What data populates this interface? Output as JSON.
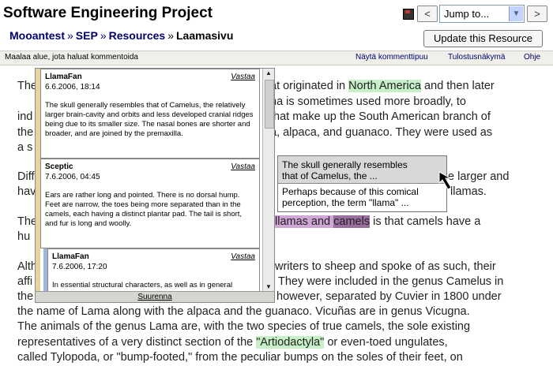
{
  "header": {
    "title": "Software Engineering Project",
    "prev_label": "<",
    "next_label": ">",
    "jump_label": "Jump to...",
    "jump_arrow": "▼"
  },
  "breadcrumb": {
    "items": [
      "Mooantest",
      "SEP",
      "Resources"
    ],
    "separator": "»",
    "current": "Laamasivu"
  },
  "update_button": "Update this Resource",
  "toolbar": {
    "hint": "Maalaa alue, jota haluat kommentoida",
    "links": [
      "Näytä kommenttipuu",
      "Tulostusnäkymä",
      "Ohje"
    ]
  },
  "content": {
    "lines": [
      {
        "pre": "The",
        "mid1": "",
        "hl1": "",
        "post": ""
      },
      {
        "pre": "",
        "mid1": "",
        "hl1": "",
        "post": ""
      }
    ],
    "l1": {
      "t1": "at originated in ",
      "hl": "North America",
      "t2": " and then later"
    },
    "l2": "na is sometimes used more broadly, to",
    "l3": "that make up the South American branch of",
    "l4": "a, alpaca, and guanaco. They were used as",
    "l5": "a s",
    "l1a": "The",
    "l2a": "ind",
    "l3a": "the",
    "l6a": "Diff",
    "l6b": "e larger and",
    "l7a": "hav",
    "l7b": "llamas.",
    "l8a": "The",
    "l8hl1": "llamas and ",
    "l8hl2": "camels",
    "l8b": " is that camels have a",
    "l9a": "hu",
    "l10a": "Alth",
    "l10b": "writers to sheep and spoke of as such, their",
    "l11a": "affi",
    "l11b": "They were included in the genus Camelus in",
    "l12a": "the",
    "l12b": "however, separated by Cuvier in 1800 under",
    "l13": "the name of Lama along with the alpaca and the guanaco. Vicuñas are in genus Vicugna.",
    "l14": "The animals of the genus Lama are, with the two species of true camels, the sole existing",
    "l15a": "representatives of a very distinct section of the ",
    "l15hl": "\"Artiodactyla\"",
    "l15b": " or even-toed ungulates,",
    "l16": "called Tylopoda, or \"bump-footed,\" from the peculiar bumps on the soles of their feet, on"
  },
  "comments": [
    {
      "author": "LlamaFan",
      "date": "6.6.2006, 18:14",
      "reply": "Vastaa",
      "body": "The skull generally resembles that of Camelus, the relatively larger brain-cavity and orbits and less developed cranial ridges being due to its smaller size. The nasal bones are shorter and broader, and are joined by the premaxilla."
    },
    {
      "author": "Sceptic",
      "date": "7.6.2006, 04:45",
      "reply": "Vastaa",
      "body": "Ears are rather long and pointed. There is no dorsal hump. Feet are narrow, the toes being more separated than in the camels, each having a distinct plantar pad. The tail is short, and fur is long and woolly."
    },
    {
      "author": "LlamaFan",
      "date": "7.6.2006, 17:20",
      "reply": "Vastaa",
      "body": "In essential structural characters, as well as in general"
    }
  ],
  "expand_label": "Suurenna",
  "popup": {
    "first_line1": "The  skull  generally  resembles",
    "first_line2": "that  of  Camelus,  the  ...",
    "second_line1": "Perhaps  because  of  this  comical",
    "second_line2": "perception,  the  term  \"llama\"  ..."
  }
}
